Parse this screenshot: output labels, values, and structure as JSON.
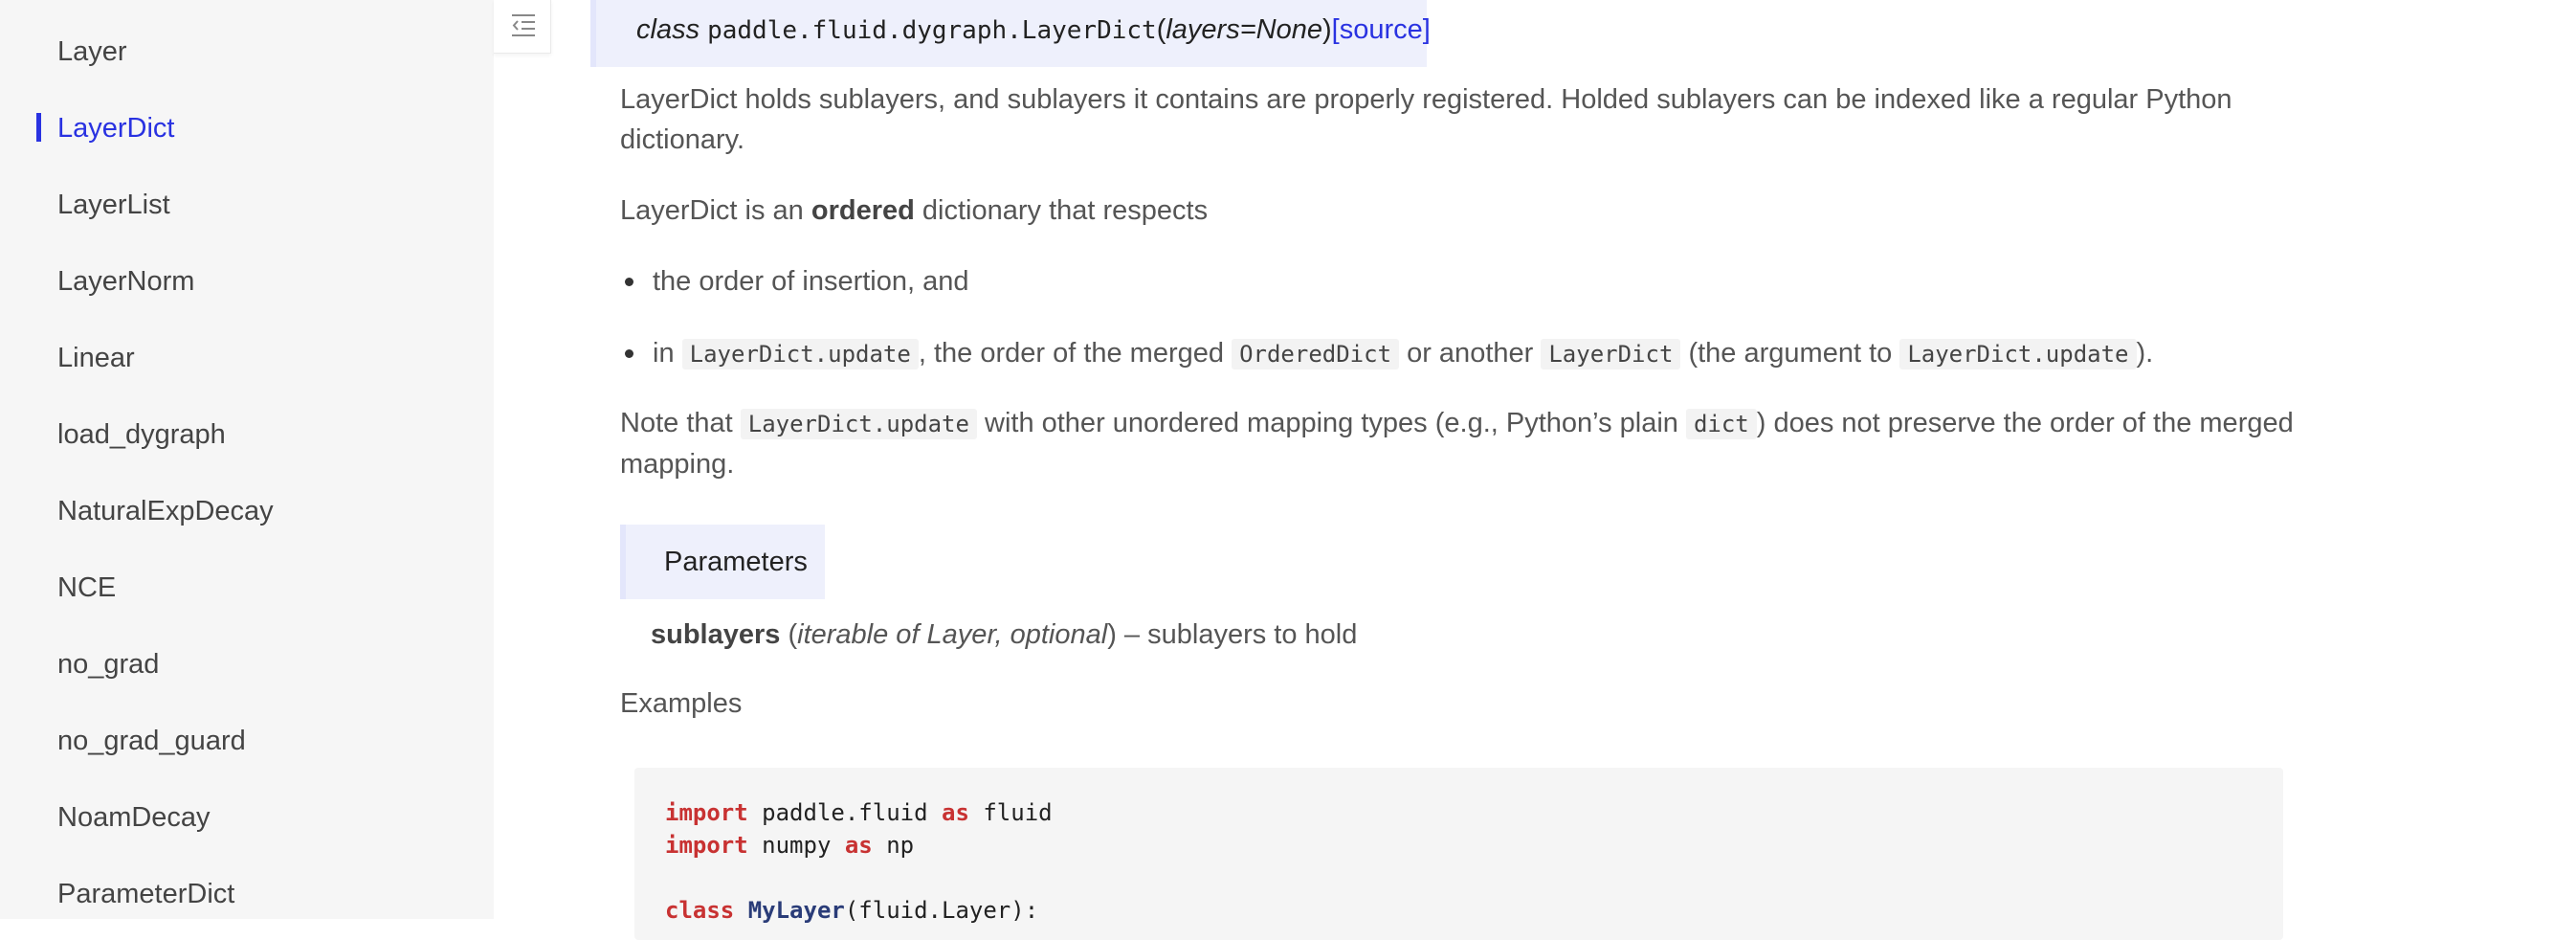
{
  "sidebar": {
    "items": [
      {
        "label": "Layer",
        "active": false
      },
      {
        "label": "LayerDict",
        "active": true
      },
      {
        "label": "LayerList",
        "active": false
      },
      {
        "label": "LayerNorm",
        "active": false
      },
      {
        "label": "Linear",
        "active": false
      },
      {
        "label": "load_dygraph",
        "active": false
      },
      {
        "label": "NaturalExpDecay",
        "active": false
      },
      {
        "label": "NCE",
        "active": false
      },
      {
        "label": "no_grad",
        "active": false
      },
      {
        "label": "no_grad_guard",
        "active": false
      },
      {
        "label": "NoamDecay",
        "active": false
      },
      {
        "label": "ParameterDict",
        "active": false
      }
    ]
  },
  "toc_toggle": {
    "icon": "menu-collapse-icon"
  },
  "signature": {
    "class_kw": "class",
    "name": "paddle.fluid.dygraph.LayerDict",
    "open": "(",
    "param": "layers=None",
    "close": ")",
    "source": "[source]"
  },
  "doc": {
    "p1": "LayerDict holds sublayers, and sublayers it contains are properly registered. Holded sublayers can be indexed like a regular Python dictionary.",
    "p2_pre": "LayerDict is an ",
    "p2_bold": "ordered",
    "p2_post": " dictionary that respects",
    "bullet1": "the order of insertion, and",
    "bullet2": {
      "t1": "in ",
      "c1": "LayerDict.update",
      "t2": ", the order of the merged ",
      "c2": "OrderedDict",
      "t3": " or another ",
      "c3": "LayerDict",
      "t4": " (the argument to ",
      "c4": "LayerDict.update",
      "t5": ")."
    },
    "note": {
      "t1": "Note that ",
      "c1": "LayerDict.update",
      "t2": " with other unordered mapping types (e.g., Python’s plain ",
      "c2": "dict",
      "t3": ") does not preserve the order of the merged mapping."
    },
    "params_title": "Parameters",
    "param_name": "sublayers",
    "param_type": "iterable of Layer, optional",
    "param_desc": " – sublayers to hold",
    "examples_label": "Examples"
  },
  "code": {
    "l1": {
      "kw1": "import",
      "t1": " paddle.fluid ",
      "kw2": "as",
      "t2": " fluid"
    },
    "l2": {
      "kw1": "import",
      "t1": " numpy ",
      "kw2": "as",
      "t2": " np"
    },
    "l4": {
      "kw1": "class",
      "t1": " ",
      "cls": "MyLayer",
      "t2": "(fluid.Layer):"
    }
  },
  "colors": {
    "accent": "#2932e1",
    "keyword": "#c83232",
    "sidebar_bg": "#f6f6f6"
  }
}
